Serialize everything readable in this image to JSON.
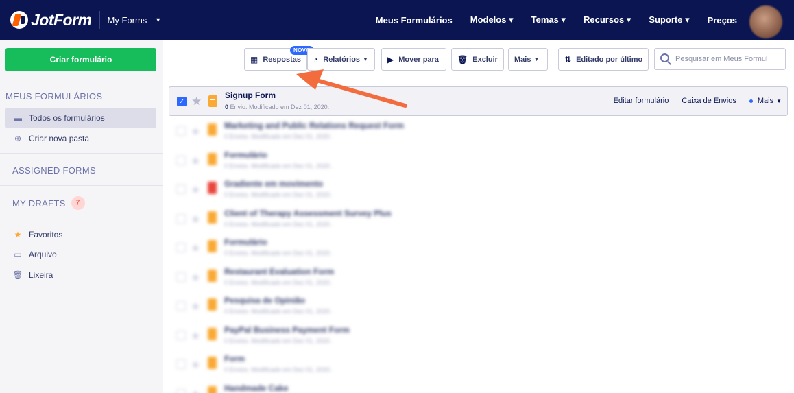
{
  "topbar": {
    "logo_text": "JotForm",
    "myforms_label": "My Forms",
    "nav": [
      "Meus Formulários",
      "Modelos ▾",
      "Temas ▾",
      "Recursos ▾",
      "Suporte ▾",
      "Preços"
    ]
  },
  "sidebar": {
    "create_button": "Criar formulário",
    "section_my_forms": "MEUS FORMULÁRIOS",
    "all_forms": "Todos os formulários",
    "new_folder": "Criar nova pasta",
    "assigned_forms": "ASSIGNED FORMS",
    "my_drafts": "MY DRAFTS",
    "drafts_count": "7",
    "favorites": "Favoritos",
    "archive": "Arquivo",
    "trash": "Lixeira"
  },
  "toolbar": {
    "responses": "Respostas",
    "new_badge": "NOVO",
    "reports": "Relatórios",
    "move_to": "Mover para",
    "delete": "Excluir",
    "more": "Mais",
    "sort": "Editado por último",
    "search_placeholder": "Pesquisar em Meus Formul"
  },
  "selected_form": {
    "title": "Signup Form",
    "submissions": "0",
    "subtitle": " Envio. Modificado em Dez 01, 2020.",
    "edit": "Editar formulário",
    "inbox": "Caixa de Envios",
    "more": "Mais"
  },
  "blurred_forms": [
    {
      "title": "Marketing and Public Relations Request Form",
      "sub": "0 Envios. Modificado em Dez 01, 2020.",
      "color": "#f9a934"
    },
    {
      "title": "Formulário",
      "sub": "0 Envios. Modificado em Dez 01, 2020.",
      "color": "#f9a934"
    },
    {
      "title": "Gradiente em movimento",
      "sub": "0 Envios. Modificado em Dez 01, 2020.",
      "color": "#e9453b"
    },
    {
      "title": "Client of Therapy Assessment Survey Plus",
      "sub": "0 Envios. Modificado em Dez 01, 2020.",
      "color": "#f9a934"
    },
    {
      "title": "Formulário",
      "sub": "0 Envios. Modificado em Dez 01, 2020.",
      "color": "#f9a934"
    },
    {
      "title": "Restaurant Evaluation Form",
      "sub": "0 Envios. Modificado em Dez 01, 2020.",
      "color": "#f9a934"
    },
    {
      "title": "Pesquisa de Opinião",
      "sub": "0 Envios. Modificado em Dez 01, 2020.",
      "color": "#f9a934"
    },
    {
      "title": "PayPal Business Payment Form",
      "sub": "0 Envios. Modificado em Dez 01, 2020.",
      "color": "#f9a934"
    },
    {
      "title": "Form",
      "sub": "0 Envios. Modificado em Dez 01, 2020.",
      "color": "#f9a934"
    },
    {
      "title": "Handmade Cake",
      "sub": "0 Envios. Modificado em Dez 01, 2020.",
      "color": "#f9a934"
    }
  ],
  "colors": {
    "navbar": "#0a1551",
    "create_button": "#18bd5b",
    "accent_blue": "#2e69ff",
    "annotation_arrow": "#f26c3d"
  }
}
